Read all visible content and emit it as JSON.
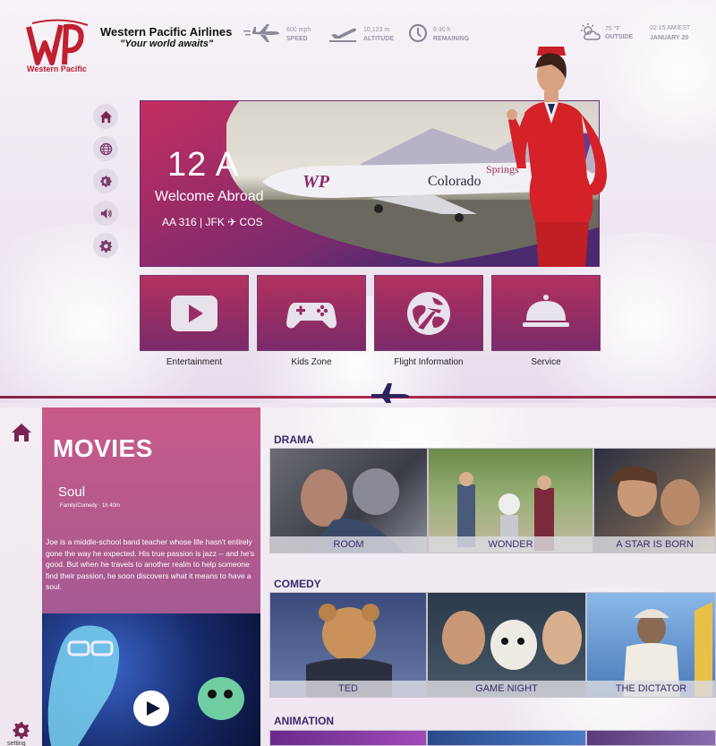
{
  "header": {
    "airline_name": "Western Pacific Airlines",
    "tagline": "\"Your world awaits\"",
    "logo_text": "Western Pacific",
    "logo_monogram": "WP"
  },
  "stats": [
    {
      "value": "600 mph",
      "label": "SPEED",
      "icon": "airplane-icon"
    },
    {
      "value": "10,123 m",
      "label": "ALTITUDE",
      "icon": "takeoff-icon"
    },
    {
      "value": "6:30 h",
      "label": "REMAINING",
      "icon": "clock-icon"
    }
  ],
  "weather": {
    "value": "75 °F",
    "label": "OUTSIDE",
    "icon": "partly-cloudy-icon"
  },
  "clock": {
    "time": "02:15 AM/EST",
    "date": "JANUARY 20"
  },
  "side_nav": [
    {
      "name": "home-icon"
    },
    {
      "name": "globe-icon"
    },
    {
      "name": "brightness-icon"
    },
    {
      "name": "volume-icon"
    },
    {
      "name": "settings-icon"
    }
  ],
  "hero": {
    "seat": "12 A",
    "welcome": "Welcome Abroad",
    "route": "AA 316 | JFK ✈ COS"
  },
  "tiles": [
    {
      "label": "Entertainment",
      "icon": "play-icon"
    },
    {
      "label": "Kids Zone",
      "icon": "gamepad-icon"
    },
    {
      "label": "Flight Information",
      "icon": "globe-plane-icon"
    },
    {
      "label": "Service",
      "icon": "cloche-icon"
    }
  ],
  "flight_progress": 0.545,
  "bottom": {
    "settings_label": "setting",
    "movies_title": "MOVIES",
    "featured": {
      "title": "Soul",
      "meta": "Family/Comedy · 1h 40m",
      "description": "Joe is a middle-school band teacher whose life hasn't entirely gone the way he expected. His true passion is jazz -- and he's good. But when he travels to another realm to help someone find their passion, he soon discovers what it means to have a soul."
    },
    "categories": [
      {
        "title": "DRAMA",
        "movies": [
          "ROOM",
          "WONDER",
          "A STAR IS BORN"
        ]
      },
      {
        "title": "COMEDY",
        "movies": [
          "TED",
          "GAME NIGHT",
          "THE DICTATOR"
        ]
      },
      {
        "title": "ANIMATION",
        "movies": []
      }
    ]
  },
  "colors": {
    "brand": "#b3202f",
    "accent": "#8a2b6e",
    "tile_top": "#b2325e",
    "tile_bottom": "#7a2a6a",
    "category_text": "#3a2a6a"
  }
}
